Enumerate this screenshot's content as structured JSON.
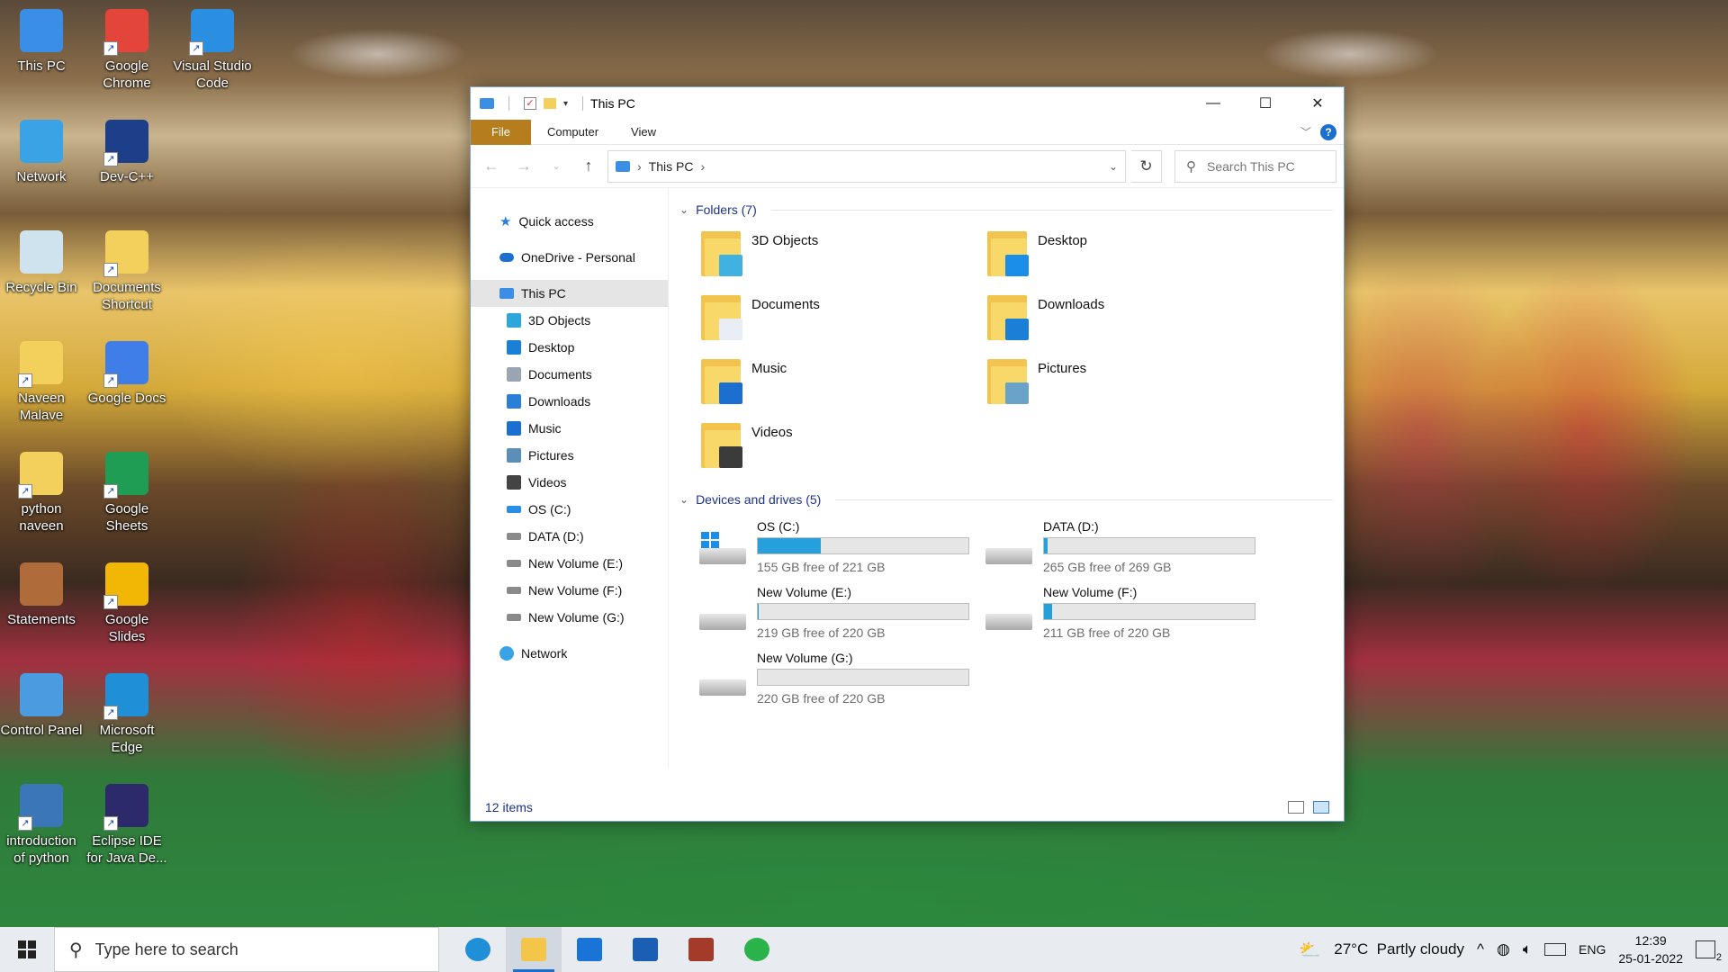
{
  "desktop": {
    "icons": [
      {
        "label": "This PC",
        "color": "#3a8ee6"
      },
      {
        "label": "Google Chrome",
        "color": "#e4453a"
      },
      {
        "label": "Visual Studio Code",
        "color": "#2a8fe0"
      },
      {
        "label": "Network",
        "color": "#3aa3e6"
      },
      {
        "label": "Dev-C++",
        "color": "#1d3f8a"
      },
      {
        "label": "Recycle Bin",
        "color": "#cfe3ef"
      },
      {
        "label": "Documents Shortcut",
        "color": "#f3cf5c"
      },
      {
        "label": "Naveen Malave",
        "color": "#f3cf5c"
      },
      {
        "label": "Google Docs",
        "color": "#3f7ee8"
      },
      {
        "label": "python naveen",
        "color": "#f3cf5c"
      },
      {
        "label": "Google Sheets",
        "color": "#1f9d55"
      },
      {
        "label": "Statements",
        "color": "#b06b3a"
      },
      {
        "label": "Google Slides",
        "color": "#f2b705"
      },
      {
        "label": "Control Panel",
        "color": "#4a9be0"
      },
      {
        "label": "Microsoft Edge",
        "color": "#1f8fd8"
      },
      {
        "label": "introduction of python",
        "color": "#3b77b8"
      },
      {
        "label": "Eclipse IDE for Java De...",
        "color": "#2c2a6b"
      }
    ]
  },
  "window": {
    "title": "This PC",
    "tabs": {
      "file": "File",
      "computer": "Computer",
      "view": "View"
    },
    "help": "?",
    "address": {
      "location": "This PC"
    },
    "search_placeholder": "Search This PC",
    "nav": {
      "quick_access": "Quick access",
      "onedrive": "OneDrive - Personal",
      "this_pc": "This PC",
      "children": [
        {
          "label": "3D Objects",
          "color": "#2fa6d9"
        },
        {
          "label": "Desktop",
          "color": "#1a7fd6"
        },
        {
          "label": "Documents",
          "color": "#9aa5b4"
        },
        {
          "label": "Downloads",
          "color": "#2a7fd6"
        },
        {
          "label": "Music",
          "color": "#1a6fd0"
        },
        {
          "label": "Pictures",
          "color": "#5b8fb8"
        },
        {
          "label": "Videos",
          "color": "#444"
        },
        {
          "label": "OS (C:)",
          "color": "#2a8ee6"
        },
        {
          "label": "DATA (D:)",
          "color": "#8a8a8a"
        },
        {
          "label": "New Volume (E:)",
          "color": "#8a8a8a"
        },
        {
          "label": "New Volume (F:)",
          "color": "#8a8a8a"
        },
        {
          "label": "New Volume (G:)",
          "color": "#8a8a8a"
        }
      ],
      "network": "Network"
    },
    "folders_header": "Folders (7)",
    "folders": [
      {
        "label": "3D Objects",
        "badge": "#3fb2e2"
      },
      {
        "label": "Desktop",
        "badge": "#1a8ee8"
      },
      {
        "label": "Documents",
        "badge": "#e9eef5"
      },
      {
        "label": "Downloads",
        "badge": "#1a7fd6"
      },
      {
        "label": "Music",
        "badge": "#1a6fd0"
      },
      {
        "label": "Pictures",
        "badge": "#6aa3c9"
      },
      {
        "label": "Videos",
        "badge": "#3b3b3b"
      }
    ],
    "drives_header": "Devices and drives (5)",
    "drives": [
      {
        "label": "OS (C:)",
        "free": "155 GB free of 221 GB",
        "used_fraction": 0.3,
        "system": true
      },
      {
        "label": "DATA (D:)",
        "free": "265 GB free of 269 GB",
        "used_fraction": 0.015,
        "system": false
      },
      {
        "label": "New Volume (E:)",
        "free": "219 GB free of 220 GB",
        "used_fraction": 0.005,
        "system": false
      },
      {
        "label": "New Volume (F:)",
        "free": "211 GB free of 220 GB",
        "used_fraction": 0.04,
        "system": false
      },
      {
        "label": "New Volume (G:)",
        "free": "220 GB free of 220 GB",
        "used_fraction": 0.0,
        "system": false
      }
    ],
    "status": "12 items"
  },
  "taskbar": {
    "search_placeholder": "Type here to search",
    "apps": [
      {
        "name": "Microsoft Edge",
        "color": "#1f8fd8",
        "active": false
      },
      {
        "name": "File Explorer",
        "color": "#f3c64a",
        "active": true
      },
      {
        "name": "Mail",
        "color": "#1a73d6",
        "active": false
      },
      {
        "name": "Dell",
        "color": "#1a5fb4",
        "active": false
      },
      {
        "name": "Photo app",
        "color": "#a33a2a",
        "active": false
      },
      {
        "name": "WhatsApp",
        "color": "#29b34a",
        "active": false
      }
    ],
    "weather": "27°C  Partly cloudy",
    "lang": "ENG",
    "time": "12:39",
    "date": "25-01-2022",
    "notifications": "2"
  }
}
